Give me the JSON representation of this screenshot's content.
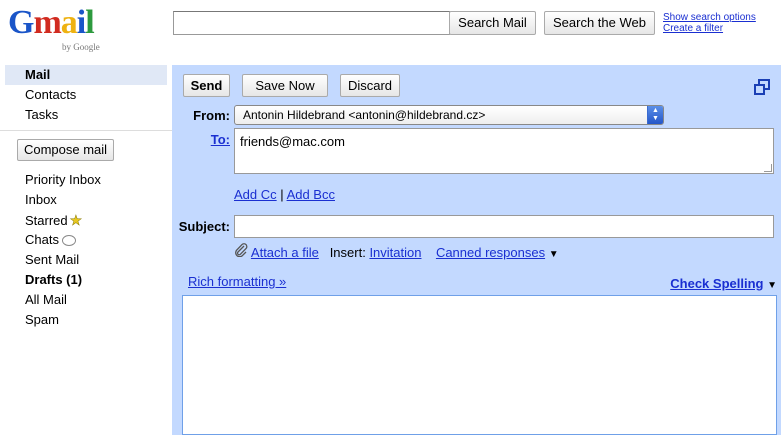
{
  "logo": {
    "g": "G",
    "m": "m",
    "a": "a",
    "i": "i",
    "l": "l",
    "sub": "by Google"
  },
  "search": {
    "value": "",
    "search_mail_label": "Search Mail",
    "search_web_label": "Search the Web",
    "show_options_label": "Show search options",
    "create_filter_label": "Create a filter"
  },
  "sidebar": {
    "top_items": [
      {
        "label": "Mail",
        "active": true
      },
      {
        "label": "Contacts"
      },
      {
        "label": "Tasks"
      }
    ],
    "compose_label": "Compose mail",
    "folders": [
      {
        "label": "Priority Inbox"
      },
      {
        "label": "Inbox"
      },
      {
        "label": "Starred",
        "icon": "star-icon"
      },
      {
        "label": "Chats",
        "icon": "chat-bubble-icon"
      },
      {
        "label": "Sent Mail"
      },
      {
        "label": "Drafts (1)",
        "bold": true
      },
      {
        "label": "All Mail"
      },
      {
        "label": "Spam"
      }
    ]
  },
  "compose": {
    "send_label": "Send",
    "save_label": "Save Now",
    "discard_label": "Discard",
    "from_label": "From:",
    "from_value": "Antonin Hildebrand <antonin@hildebrand.cz>",
    "to_label": "To:",
    "to_value": "friends@mac.com",
    "add_cc_label": "Add Cc",
    "cc_separator": "|",
    "add_bcc_label": "Add Bcc",
    "subject_label": "Subject:",
    "subject_value": "",
    "attach_label": "Attach a file",
    "insert_label": "Insert:",
    "invitation_label": "Invitation",
    "canned_label": "Canned responses",
    "canned_arrow": "▼",
    "rich_formatting_label": "Rich formatting »",
    "check_spelling_label": "Check Spelling",
    "spelling_arrow": "▼",
    "body_value": ""
  },
  "colors": {
    "compose_bg": "#c3d9ff",
    "link": "#1a2fd1",
    "nav_active": "#e0e8f6"
  }
}
